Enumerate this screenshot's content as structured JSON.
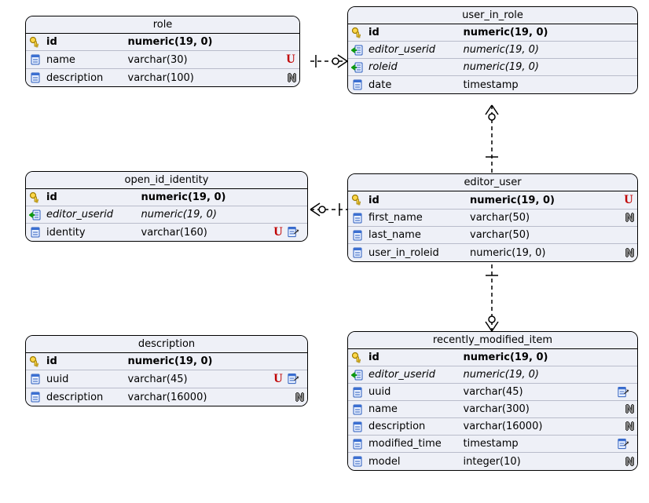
{
  "entities": {
    "role": {
      "title": "role",
      "cols": [
        {
          "icon": "key",
          "name": "id",
          "type": "numeric(19, 0)",
          "pk": true,
          "badges": []
        },
        {
          "icon": "col",
          "name": "name",
          "type": "varchar(30)",
          "badges": [
            "U"
          ]
        },
        {
          "icon": "col",
          "name": "description",
          "type": "varchar(100)",
          "badges": [
            "N"
          ]
        }
      ]
    },
    "user_in_role": {
      "title": "user_in_role",
      "cols": [
        {
          "icon": "key",
          "name": "id",
          "type": "numeric(19, 0)",
          "pk": true,
          "badges": []
        },
        {
          "icon": "fk",
          "name": "editor_userid",
          "type": "numeric(19, 0)",
          "fk": true,
          "badges": []
        },
        {
          "icon": "fk",
          "name": "roleid",
          "type": "numeric(19, 0)",
          "fk": true,
          "badges": []
        },
        {
          "icon": "col",
          "name": "date",
          "type": "timestamp",
          "badges": []
        }
      ]
    },
    "open_id_identity": {
      "title": "open_id_identity",
      "cols": [
        {
          "icon": "key",
          "name": "id",
          "type": "numeric(19, 0)",
          "pk": true,
          "badges": []
        },
        {
          "icon": "fk",
          "name": "editor_userid",
          "type": "numeric(19, 0)",
          "fk": true,
          "badges": []
        },
        {
          "icon": "col",
          "name": "identity",
          "type": "varchar(160)",
          "badges": [
            "U",
            "idx"
          ]
        }
      ]
    },
    "editor_user": {
      "title": "editor_user",
      "cols": [
        {
          "icon": "key",
          "name": "id",
          "type": "numeric(19, 0)",
          "pk": true,
          "badges": [
            "U"
          ]
        },
        {
          "icon": "col",
          "name": "first_name",
          "type": "varchar(50)",
          "badges": [
            "N"
          ]
        },
        {
          "icon": "col",
          "name": "last_name",
          "type": "varchar(50)",
          "badges": []
        },
        {
          "icon": "col",
          "name": "user_in_roleid",
          "type": "numeric(19, 0)",
          "badges": [
            "N"
          ]
        }
      ]
    },
    "description": {
      "title": "description",
      "cols": [
        {
          "icon": "key",
          "name": "id",
          "type": "numeric(19, 0)",
          "pk": true,
          "badges": []
        },
        {
          "icon": "col",
          "name": "uuid",
          "type": "varchar(45)",
          "badges": [
            "U",
            "idx"
          ]
        },
        {
          "icon": "col",
          "name": "description",
          "type": "varchar(16000)",
          "badges": [
            "N"
          ]
        }
      ]
    },
    "recently_modified_item": {
      "title": "recently_modified_item",
      "cols": [
        {
          "icon": "key",
          "name": "id",
          "type": "numeric(19, 0)",
          "pk": true,
          "badges": []
        },
        {
          "icon": "fk",
          "name": "editor_userid",
          "type": "numeric(19, 0)",
          "fk": true,
          "badges": []
        },
        {
          "icon": "col",
          "name": "uuid",
          "type": "varchar(45)",
          "badges": [
            "idx"
          ]
        },
        {
          "icon": "col",
          "name": "name",
          "type": "varchar(300)",
          "badges": [
            "N"
          ]
        },
        {
          "icon": "col",
          "name": "description",
          "type": "varchar(16000)",
          "badges": [
            "N"
          ]
        },
        {
          "icon": "col",
          "name": "modified_time",
          "type": "timestamp",
          "badges": [
            "idx"
          ]
        },
        {
          "icon": "col",
          "name": "model",
          "type": "integer(10)",
          "badges": [
            "N"
          ]
        }
      ]
    }
  }
}
